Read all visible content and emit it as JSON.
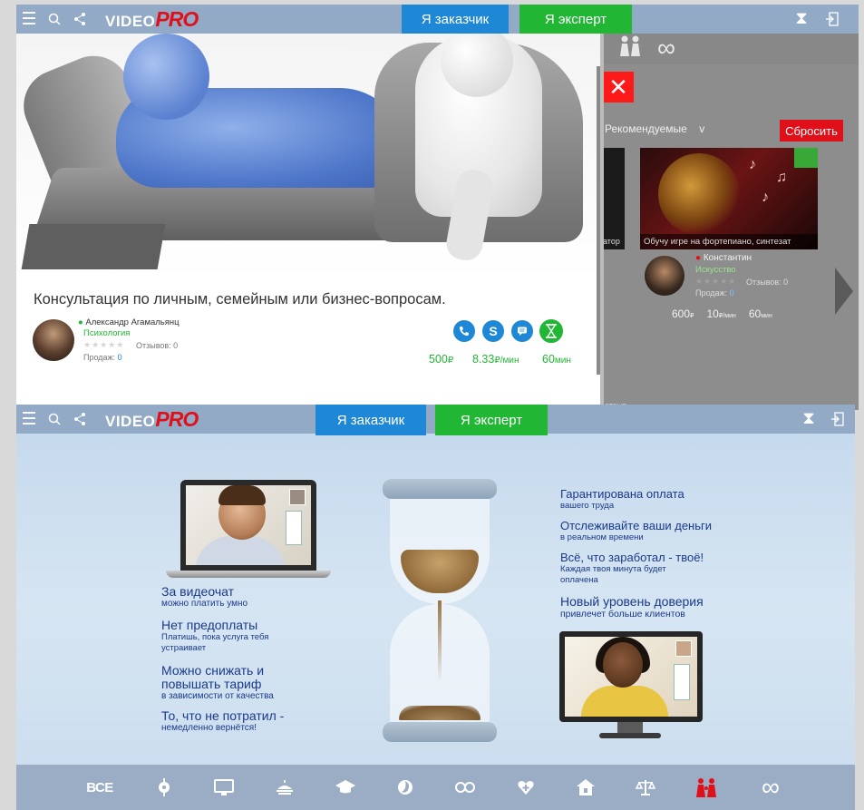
{
  "app": {
    "logo_video": "VIDEO",
    "logo_pro": "PRO",
    "customer_label": "Я заказчик",
    "expert_label": "Я эксперт"
  },
  "top": {
    "service_title": "Консультация по личным, семейным или бизнес-вопросам.",
    "expert": {
      "name": "Александр Агамальянц",
      "category": "Психология",
      "reviews": "Отзывов: 0",
      "sales_label": "Продаж:",
      "sales_value": "0"
    },
    "prices": {
      "fixed_value": "500",
      "fixed_unit": "₽",
      "per_min_value": "8.33",
      "per_min_unit": "₽/мин",
      "duration_value": "60",
      "duration_unit": "мин"
    },
    "background": {
      "sort_label": "Рекомендуемые",
      "sort_chevron": "v",
      "reset_label": "Сбросить",
      "left_caption": "атор",
      "card_caption": "Обучу игре на фортепиано, синтезат",
      "card_expert_name": "Константин",
      "card_expert_category": "Искусство",
      "card_reviews": "Отзывов: 0",
      "card_sales_label": "Продаж:",
      "card_sales_value": "0",
      "card_price_fixed": "600",
      "card_price_fixed_unit": "₽",
      "card_price_per_min": "10",
      "card_price_per_min_unit": "₽/мин",
      "card_duration": "60",
      "card_duration_unit": "мин",
      "bottom_text": "отзыв"
    }
  },
  "bottom": {
    "left_features": [
      {
        "title": "За видеочат",
        "sub": "можно платить умно"
      },
      {
        "title": "Нет предоплаты",
        "sub": "Платишь, пока услуга тебя устраивает"
      },
      {
        "title": "Можно снижать и повышать тариф",
        "sub": "в зависимости от качества"
      },
      {
        "title": "То, что не потратил -",
        "sub": "немедленно вернётся!"
      }
    ],
    "right_features": [
      {
        "title": "Гарантирована оплата",
        "sub": "вашего труда"
      },
      {
        "title": "Отслеживайте ваши деньги",
        "sub": "в реальном времени"
      },
      {
        "title": "Всё, что заработал - твоё!",
        "sub": "Каждая твоя минута будет оплачена"
      },
      {
        "title": "Новый уровень доверия",
        "sub": "привлечет больше клиентов"
      }
    ],
    "categories_all_label": "ВСЕ"
  },
  "colors": {
    "header_bg": "#93aac6",
    "customer_blue": "#1e88d6",
    "expert_green": "#21b634",
    "brand_red": "#e0101a",
    "feature_text": "#1a3a8a"
  }
}
